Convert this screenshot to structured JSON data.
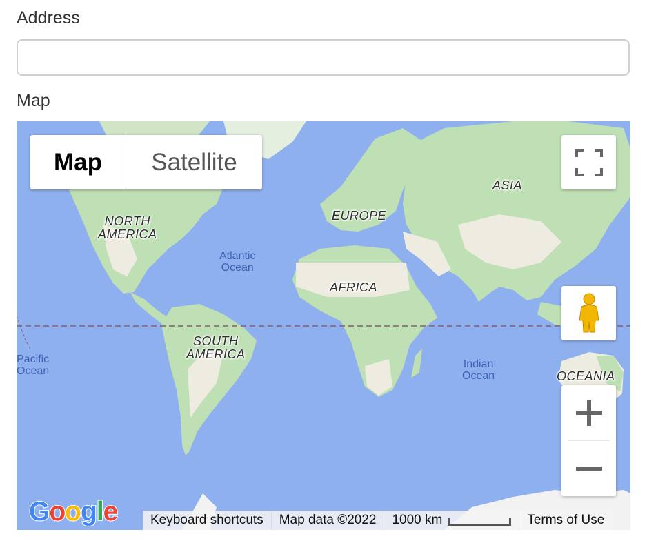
{
  "form": {
    "address_label": "Address",
    "address_value": "",
    "address_placeholder": "",
    "map_label": "Map"
  },
  "map": {
    "type_buttons": {
      "map": "Map",
      "satellite": "Satellite"
    },
    "selected_type": "Map",
    "labels": {
      "north_america": "NORTH\nAMERICA",
      "south_america": "SOUTH\nAMERICA",
      "europe": "EUROPE",
      "africa": "AFRICA",
      "asia": "ASIA",
      "oceania": "OCEANIA",
      "atlantic": "Atlantic\nOcean",
      "pacific": "Pacific\nOcean",
      "indian": "Indian\nOcean"
    },
    "attribution": {
      "keyboard": "Keyboard shortcuts",
      "map_data": "Map data ©2022",
      "scale": "1000 km",
      "terms": "Terms of Use"
    },
    "logo_letters": [
      "G",
      "o",
      "o",
      "g",
      "l",
      "e"
    ],
    "colors": {
      "water": "#8fb0ee",
      "land_green": "#bfe0b5",
      "land_tan": "#eeebe0",
      "ice": "#f2f2f2",
      "equator": "#8a5d6a",
      "pegman": "#f2b705"
    },
    "icons": [
      "fullscreen-icon",
      "pegman-icon",
      "zoom-in-icon",
      "zoom-out-icon"
    ]
  }
}
